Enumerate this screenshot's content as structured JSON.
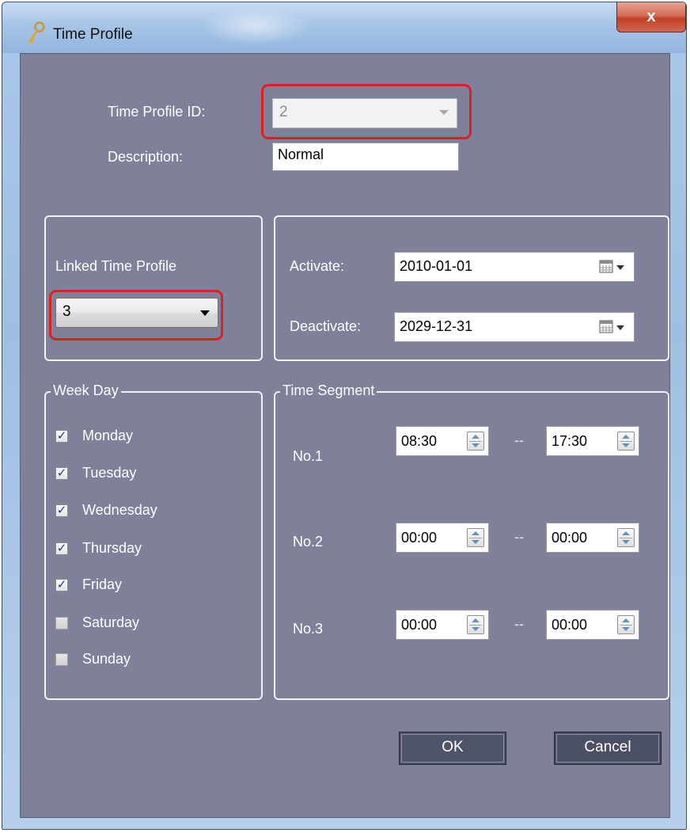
{
  "window": {
    "title": "Time Profile",
    "close_label": "x"
  },
  "form": {
    "profile_id_label": "Time Profile ID:",
    "profile_id_value": "2",
    "description_label": "Description:",
    "description_value": "Normal"
  },
  "linked": {
    "label": "Linked Time Profile",
    "value": "3"
  },
  "dates": {
    "activate_label": "Activate:",
    "activate_value": "2010-01-01",
    "deactivate_label": "Deactivate:",
    "deactivate_value": "2029-12-31"
  },
  "weekday": {
    "title": "Week Day",
    "days": [
      {
        "label": "Monday",
        "checked": true
      },
      {
        "label": "Tuesday",
        "checked": true
      },
      {
        "label": "Wednesday",
        "checked": true
      },
      {
        "label": "Thursday",
        "checked": true
      },
      {
        "label": "Friday",
        "checked": true
      },
      {
        "label": "Saturday",
        "checked": false
      },
      {
        "label": "Sunday",
        "checked": false
      }
    ]
  },
  "segments": {
    "title": "Time Segment",
    "separator": "--",
    "rows": [
      {
        "label": "No.1",
        "start": "08:30",
        "end": "17:30"
      },
      {
        "label": "No.2",
        "start": "00:00",
        "end": "00:00"
      },
      {
        "label": "No.3",
        "start": "00:00",
        "end": "00:00"
      }
    ]
  },
  "buttons": {
    "ok": "OK",
    "cancel": "Cancel"
  },
  "colors": {
    "panel": "#7e8199",
    "highlight": "#e0201c"
  },
  "icons": {
    "title": "key-icon",
    "calendar": "calendar-icon",
    "spinner": "spinner-icon"
  }
}
